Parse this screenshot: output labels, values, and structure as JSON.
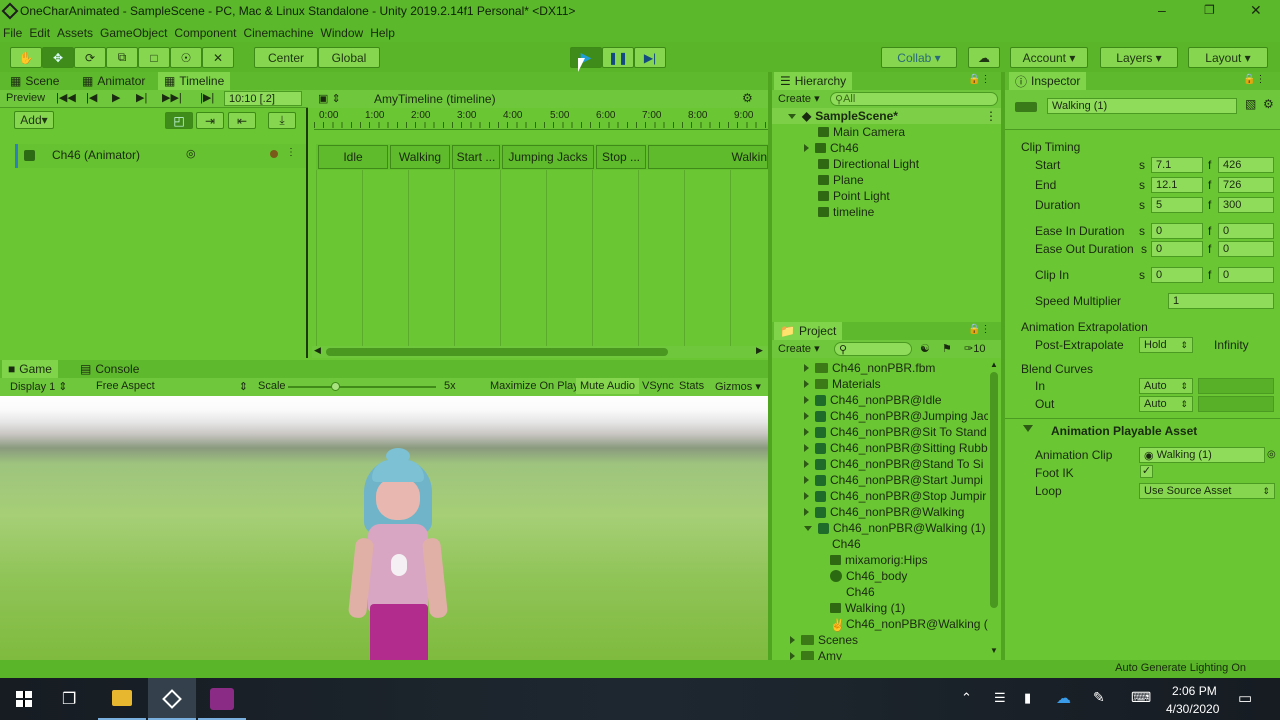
{
  "window": {
    "title": "OneCharAnimated - SampleScene - PC, Mac & Linux Standalone - Unity 2019.2.14f1 Personal* <DX11>"
  },
  "menu": [
    "File",
    "Edit",
    "Assets",
    "GameObject",
    "Component",
    "Cinemachine",
    "Window",
    "Help"
  ],
  "toolbar": {
    "center": "Center",
    "global": "Global",
    "collab": "Collab",
    "account": "Account",
    "layers": "Layers",
    "layout": "Layout"
  },
  "tabs": {
    "scene": "Scene",
    "animator": "Animator",
    "timeline": "Timeline",
    "hierarchy": "Hierarchy",
    "inspector": "Inspector",
    "project": "Project",
    "game": "Game",
    "console": "Console"
  },
  "timeline": {
    "preview": "Preview",
    "time": "10:10 [.2]",
    "asset": "AmyTimeline (timeline)",
    "add": "Add",
    "ruler": [
      "0:00",
      "1:00",
      "2:00",
      "3:00",
      "4:00",
      "5:00",
      "6:00",
      "7:00",
      "8:00",
      "9:00"
    ],
    "track": "Ch46 (Animator)",
    "clips": [
      "Idle",
      "Walking",
      "Start ...",
      "Jumping Jacks",
      "Stop ...",
      "Walkin"
    ]
  },
  "hierarchy": {
    "create": "Create",
    "search": "All",
    "scene": "SampleScene*",
    "items": [
      "Main Camera",
      "Ch46",
      "Directional Light",
      "Plane",
      "Point Light",
      "timeline"
    ]
  },
  "project": {
    "create": "Create",
    "count": "10",
    "items": [
      "Ch46_nonPBR.fbm",
      "Materials",
      "Ch46_nonPBR@Idle",
      "Ch46_nonPBR@Jumping Jac",
      "Ch46_nonPBR@Sit To Stand",
      "Ch46_nonPBR@Sitting Rubb",
      "Ch46_nonPBR@Stand To Si",
      "Ch46_nonPBR@Start Jumpi",
      "Ch46_nonPBR@Stop Jumpir",
      "Ch46_nonPBR@Walking",
      "Ch46_nonPBR@Walking (1)",
      "Ch46",
      "mixamorig:Hips",
      "Ch46_body",
      "Ch46",
      "Walking (1)",
      "Ch46_nonPBR@Walking (",
      "Scenes",
      "Amy"
    ]
  },
  "game": {
    "display": "Display 1",
    "aspect": "Free Aspect",
    "scale": "Scale",
    "scale_val": "5x",
    "maximize": "Maximize On Play",
    "mute": "Mute Audio",
    "vsync": "VSync",
    "stats": "Stats",
    "gizmos": "Gizmos"
  },
  "inspector": {
    "clip_name": "Walking (1)",
    "clip_timing": "Clip Timing",
    "start": "Start",
    "start_s": "7.1",
    "start_f": "426",
    "end": "End",
    "end_s": "12.1",
    "end_f": "726",
    "duration": "Duration",
    "duration_s": "5",
    "duration_f": "300",
    "ease_in": "Ease In Duration",
    "ease_in_s": "0",
    "ease_in_f": "0",
    "ease_out": "Ease Out Duration",
    "ease_out_s": "0",
    "ease_out_f": "0",
    "clip_in": "Clip In",
    "clip_in_s": "0",
    "clip_in_f": "0",
    "s": "s",
    "f": "f",
    "speed": "Speed Multiplier",
    "speed_val": "1",
    "extrapolation": "Animation Extrapolation",
    "post": "Post-Extrapolate",
    "post_val": "Hold",
    "post_inf": "Infinity",
    "blend": "Blend Curves",
    "in": "In",
    "in_val": "Auto",
    "out": "Out",
    "out_val": "Auto",
    "playable": "Animation Playable Asset",
    "anim_clip": "Animation Clip",
    "anim_clip_val": "Walking (1)",
    "foot_ik": "Foot IK",
    "loop": "Loop",
    "loop_val": "Use Source Asset"
  },
  "status": {
    "lighting": "Auto Generate Lighting On"
  },
  "taskbar": {
    "time": "2:06 PM",
    "date": "4/30/2020"
  }
}
